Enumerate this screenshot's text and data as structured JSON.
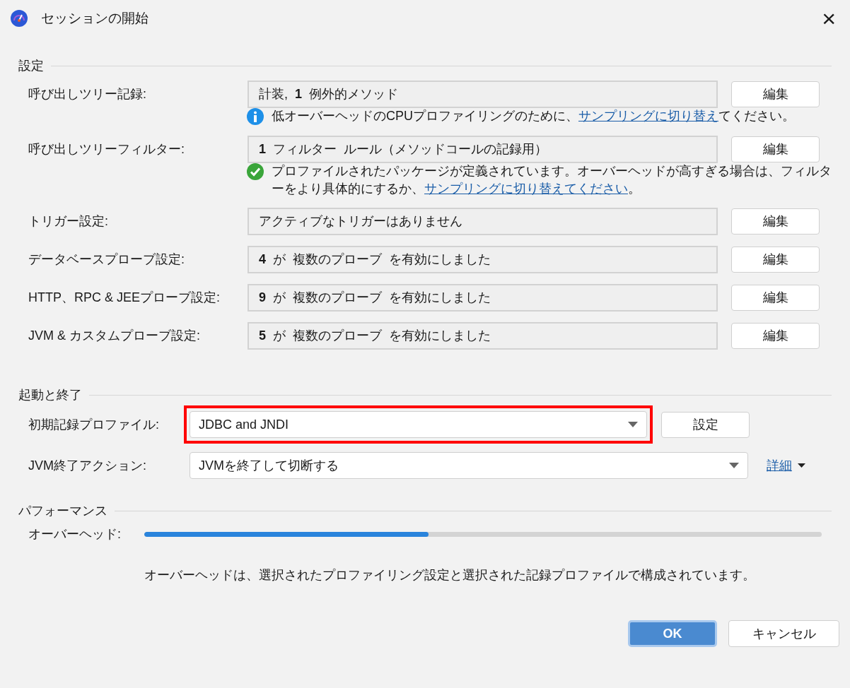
{
  "window": {
    "title": "セッションの開始",
    "close": "×"
  },
  "settings": {
    "title": "設定",
    "rows": [
      {
        "label": "呼び出しツリー記録:",
        "value": "計装, **1** 例外的メソッド",
        "button": "編集",
        "note": {
          "kind": "info",
          "before": "低オーバーヘッドのCPUプロファイリングのために、",
          "link": "サンプリングに切り替え",
          "after": "てください。"
        }
      },
      {
        "label": "呼び出しツリーフィルター:",
        "value": "**1** フィルター ルール（メソッドコールの記録用）",
        "button": "編集",
        "note": {
          "kind": "ok",
          "before": "プロファイルされたパッケージが定義されています。オーバーヘッドが高すぎる場合は、フィルターをより具体的にするか、",
          "link": "サンプリングに切り替えてください",
          "after": "。"
        }
      },
      {
        "label": "トリガー設定:",
        "value": "アクティブなトリガーはありません",
        "button": "編集"
      },
      {
        "label": "データベースプローブ設定:",
        "value": "**4** が 複数のプローブ を有効にしました",
        "button": "編集"
      },
      {
        "label": "HTTP、RPC & JEEプローブ設定:",
        "value": "**9** が 複数のプローブ を有効にしました",
        "button": "編集"
      },
      {
        "label": "JVM & カスタムプローブ設定:",
        "value": "**5** が 複数のプローブ を有効にしました",
        "button": "編集"
      }
    ]
  },
  "startup": {
    "title": "起動と終了",
    "rows": [
      {
        "label": "初期記録プロファイル:",
        "value": "JDBC and JNDI",
        "highlighted": true,
        "button": "設定"
      },
      {
        "label": "JVM終了アクション:",
        "value": "JVMを終了して切断する",
        "highlighted": false,
        "link": "詳細"
      }
    ]
  },
  "performance": {
    "title": "パフォーマンス",
    "label": "オーバーヘッド:",
    "level": 0.42,
    "description": "オーバーヘッドは、選択されたプロファイリング設定と選択された記録プロファイルで構成されています。"
  },
  "buttons": [
    {
      "label": "OK",
      "default": true
    },
    {
      "label": "キャンセル",
      "default": false
    }
  ]
}
